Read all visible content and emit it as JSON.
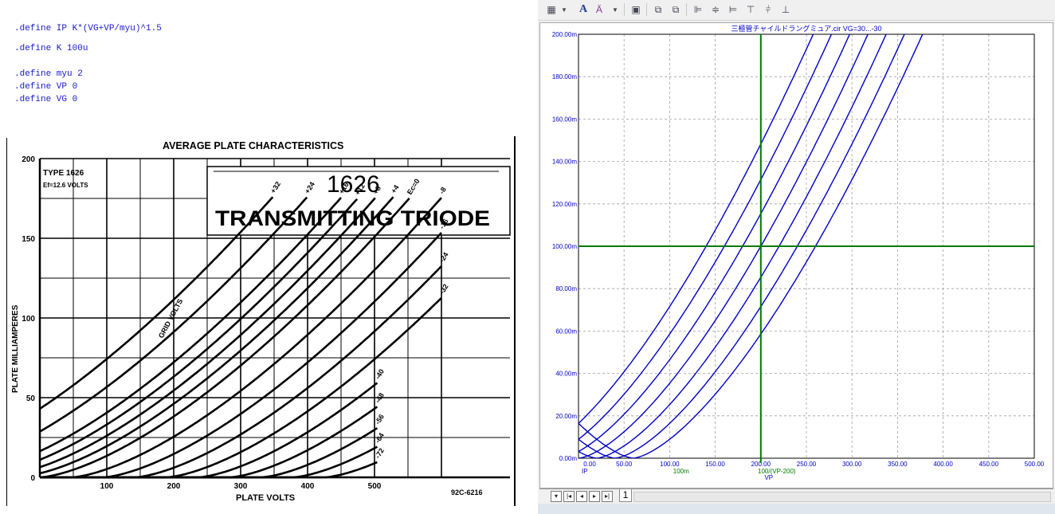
{
  "defines": [
    ".define IP K*(VG+VP/myu)^1.5",
    ".define K 100u",
    ".define myu 2",
    ".define VP 0",
    ".define VG 0"
  ],
  "datasheet": {
    "header": "AVERAGE PLATE CHARACTERISTICS",
    "type_label": "TYPE 1626",
    "ef_label": "Ef=12.6 VOLTS",
    "tube_number": "1626",
    "tube_name": "TRANSMITTING TRIODE",
    "x_label": "PLATE VOLTS",
    "y_label": "PLATE MILLIAMPERES",
    "x_ticks": [
      "100",
      "200",
      "300",
      "400",
      "500"
    ],
    "y_ticks": [
      "0",
      "50",
      "100",
      "150",
      "200"
    ],
    "curve_labels": [
      "+32",
      "+24",
      "+16",
      "+12",
      "+8",
      "+4",
      "Ec=0",
      "-8",
      "-16",
      "-24",
      "-32",
      "-40",
      "-48",
      "-56",
      "-64",
      "-72"
    ],
    "grid_volts_label": "GRID VOLTS",
    "code": "92C-6216"
  },
  "toolbar": {
    "icons": [
      "grid-icon",
      "font-icon",
      "text-style-icon",
      "copy-icon",
      "bring-front-icon",
      "send-back-icon",
      "align-left-icon",
      "align-center-icon",
      "align-right-icon",
      "align-top-icon",
      "align-middle-icon",
      "align-bottom-icon"
    ]
  },
  "plot": {
    "title": "三極管チャイルドラングミュア.cir VG=30...-30",
    "y_label": "IP",
    "x_label": "VP",
    "cursor_x_readout": "100m",
    "cursor_y_readout": "100/(VP-200)",
    "accent_color": "#0000c8",
    "cursor_color": "#007a00",
    "grid": "dashed",
    "sheet_tab": "1"
  },
  "chart_data": {
    "type": "line",
    "title": "三極管チャイルドラングミュア.cir VG=30...-30",
    "xlabel": "VP",
    "ylabel": "IP",
    "xlim": [
      0,
      500
    ],
    "ylim": [
      0,
      0.2
    ],
    "x_tick_labels": [
      "0.00",
      "50.00",
      "100.00",
      "150.00",
      "200.00",
      "250.00",
      "300.00",
      "350.00",
      "400.00",
      "450.00",
      "500.00"
    ],
    "y_tick_labels": [
      "0.00m",
      "20.00m",
      "40.00m",
      "60.00m",
      "80.00m",
      "100.00m",
      "120.00m",
      "140.00m",
      "160.00m",
      "180.00m",
      "200.00m"
    ],
    "formula": "IP = K*(VG+VP/myu)^1.5",
    "K": 0.0001,
    "myu": 2,
    "VG_values": [
      30,
      20,
      10,
      0,
      -10,
      -20,
      -30
    ],
    "cursor_x": 200,
    "cursor_y": 0.1
  }
}
